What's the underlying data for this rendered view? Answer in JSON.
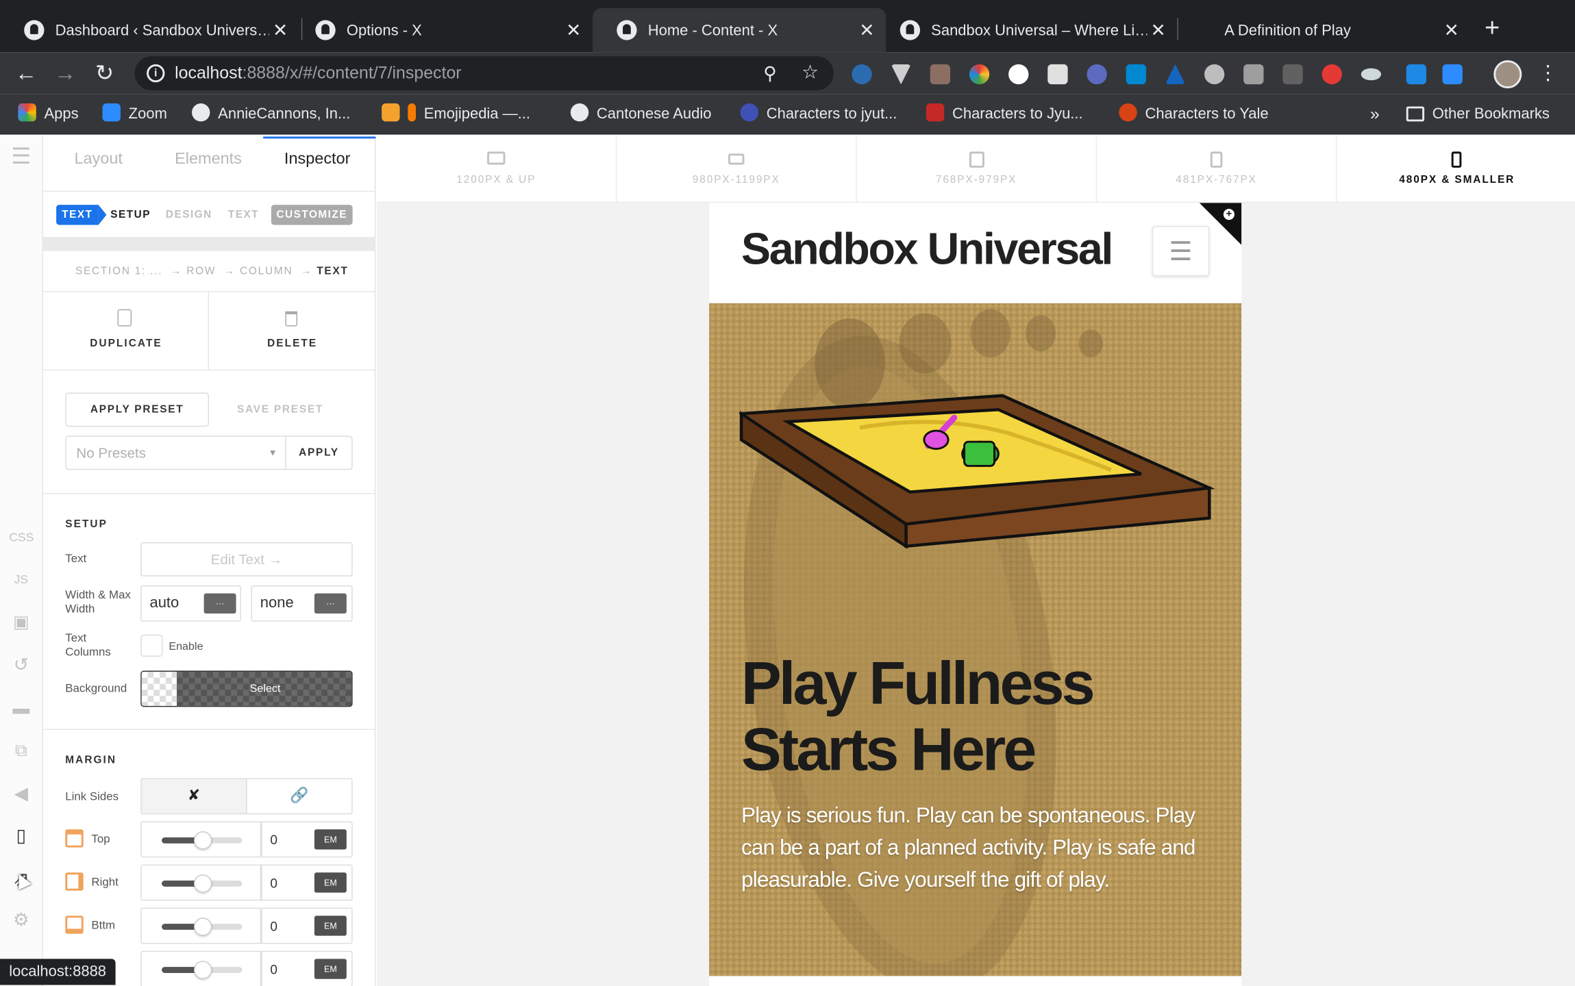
{
  "browser": {
    "tabs": [
      {
        "title": "Dashboard ‹ Sandbox Univers…",
        "close": "✕"
      },
      {
        "title": "Options - X",
        "close": "✕"
      },
      {
        "title": "Home - Content - X",
        "close": "✕"
      },
      {
        "title": "Sandbox Universal – Where Li…",
        "close": "✕"
      },
      {
        "title": "A Definition of Play",
        "close": "✕"
      }
    ],
    "new_tab": "+",
    "url_host": "localhost",
    "url_path": ":8888/x/#/content/7/inspector",
    "bookmarks": [
      "Apps",
      "Zoom",
      "AnnieCannons, In...",
      "Emojipedia —...",
      "Cantonese Audio",
      "Characters to jyut...",
      "Characters to Jyu...",
      "Characters to Yale"
    ],
    "bookmarks_more": "»",
    "other_bookmarks": "Other Bookmarks",
    "status_url": "localhost:8888"
  },
  "rail": {
    "css": "CSS",
    "js": "JS"
  },
  "panel": {
    "tabs": [
      "Layout",
      "Elements",
      "Inspector"
    ],
    "subtabs": {
      "text_badge": "TEXT",
      "setup": "SETUP",
      "design": "DESIGN",
      "text": "TEXT",
      "customize": "CUSTOMIZE"
    },
    "breadcrumb": {
      "section": "SECTION 1: ...",
      "row": "ROW",
      "column": "COLUMN",
      "text": "TEXT",
      "arrow": "→"
    },
    "duplicate": "DUPLICATE",
    "delete": "DELETE",
    "apply_preset": "APPLY PRESET",
    "save_preset": "SAVE PRESET",
    "preset_placeholder": "No Presets",
    "apply": "APPLY",
    "setup_heading": "SETUP",
    "text_label": "Text",
    "edit_text": "Edit Text →",
    "width_label": "Width & Max Width",
    "width_value": "auto",
    "max_width_value": "none",
    "dots": "···",
    "columns_label": "Text Columns",
    "enable": "Enable",
    "background_label": "Background",
    "select": "Select",
    "margin_heading": "MARGIN",
    "link_sides": "Link Sides",
    "margins": [
      {
        "label": "Top",
        "value": "0",
        "unit": "EM"
      },
      {
        "label": "Right",
        "value": "0",
        "unit": "EM"
      },
      {
        "label": "Bttm",
        "value": "0",
        "unit": "EM"
      },
      {
        "label": "",
        "value": "0",
        "unit": "EM"
      }
    ]
  },
  "viewports": [
    {
      "label": "1200PX & UP",
      "active": false
    },
    {
      "label": "980PX-1199PX",
      "active": false
    },
    {
      "label": "768PX-979PX",
      "active": false
    },
    {
      "label": "481PX-767PX",
      "active": false
    },
    {
      "label": "480PX & SMALLER",
      "active": true
    }
  ],
  "site": {
    "brand": "Sandbox Universal",
    "headline_line1": "Play Fullness",
    "headline_line2": "Starts Here",
    "body": "Play is serious fun. Play can be spontaneous. Play can be a part of a planned activity. Play is safe and pleasurable. Give yourself the gift of play."
  }
}
